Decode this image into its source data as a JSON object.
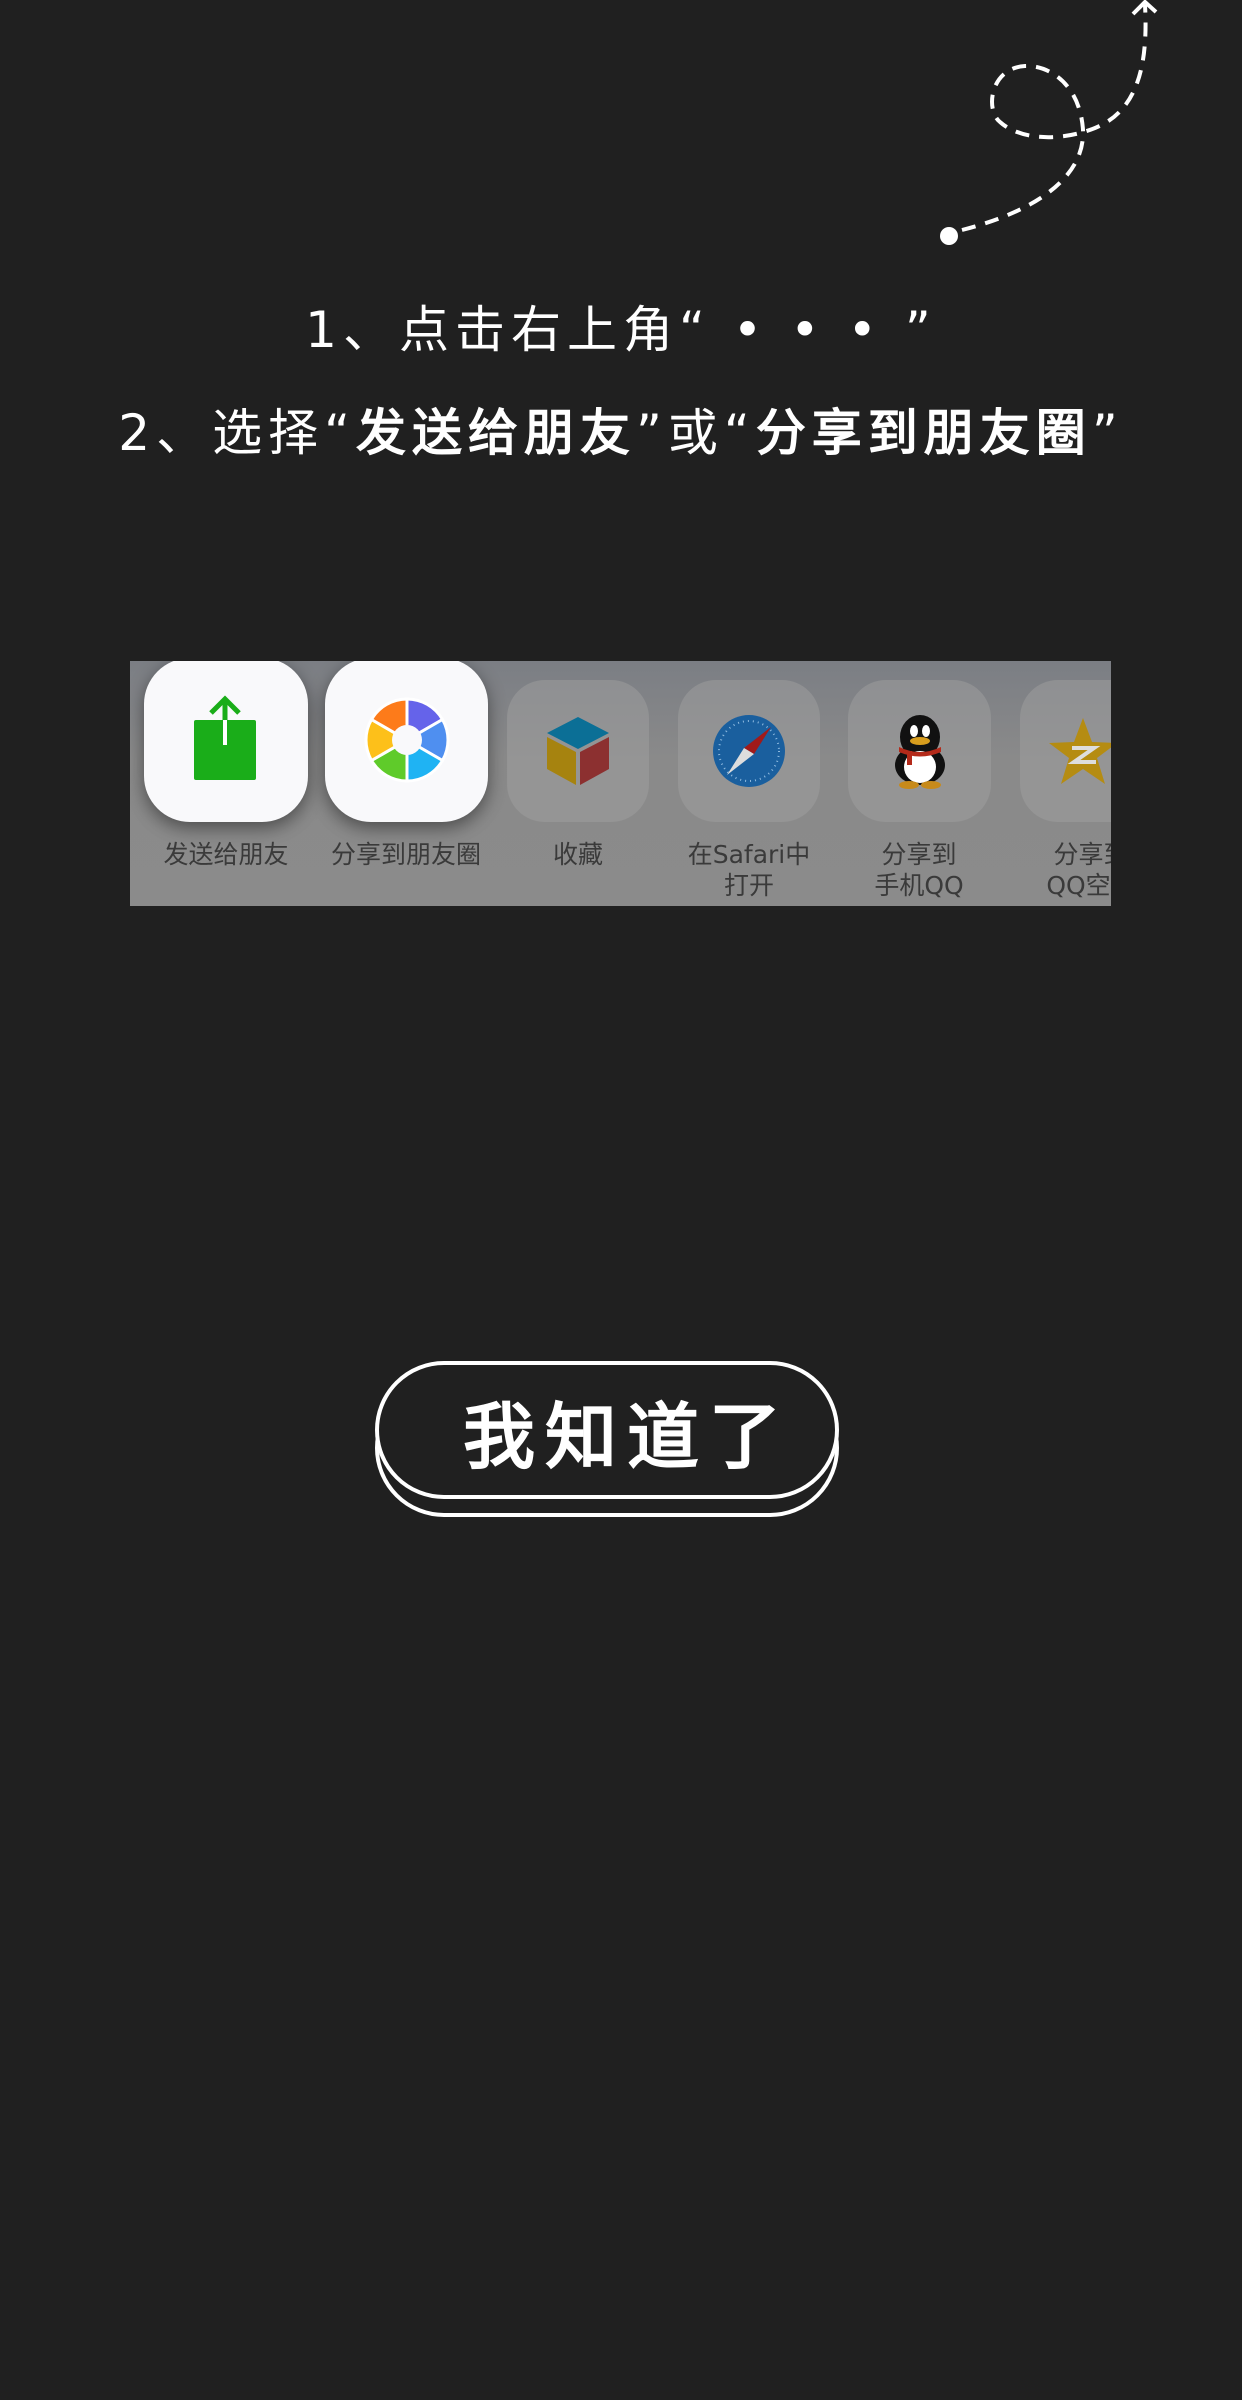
{
  "instructions": {
    "step1": "1、点击右上角“ • • • ”",
    "step2_prefix": "2、选择“",
    "step2_option1": "发送给朋友",
    "step2_middle": "”或“",
    "step2_option2": "分享到朋友圈",
    "step2_suffix": "”"
  },
  "share_panel": {
    "items": [
      {
        "label": "发送给朋友",
        "icon": "share-upload-icon",
        "highlighted": true
      },
      {
        "label": "分享到朋友圈",
        "icon": "moments-aperture-icon",
        "highlighted": true
      },
      {
        "label": "收藏",
        "icon": "favorite-cube-icon",
        "highlighted": false
      },
      {
        "label": "在Safari中",
        "label2": "打开",
        "icon": "safari-compass-icon",
        "highlighted": false
      },
      {
        "label": "分享到",
        "label2": "手机QQ",
        "icon": "qq-penguin-icon",
        "highlighted": false
      },
      {
        "label": "分享到",
        "label2": "QQ空间",
        "icon": "qzone-star-icon",
        "highlighted": false
      }
    ]
  },
  "confirm_button": {
    "label": "我知道了"
  },
  "colors": {
    "background": "#202020",
    "wechat_green": "#1aad19"
  }
}
